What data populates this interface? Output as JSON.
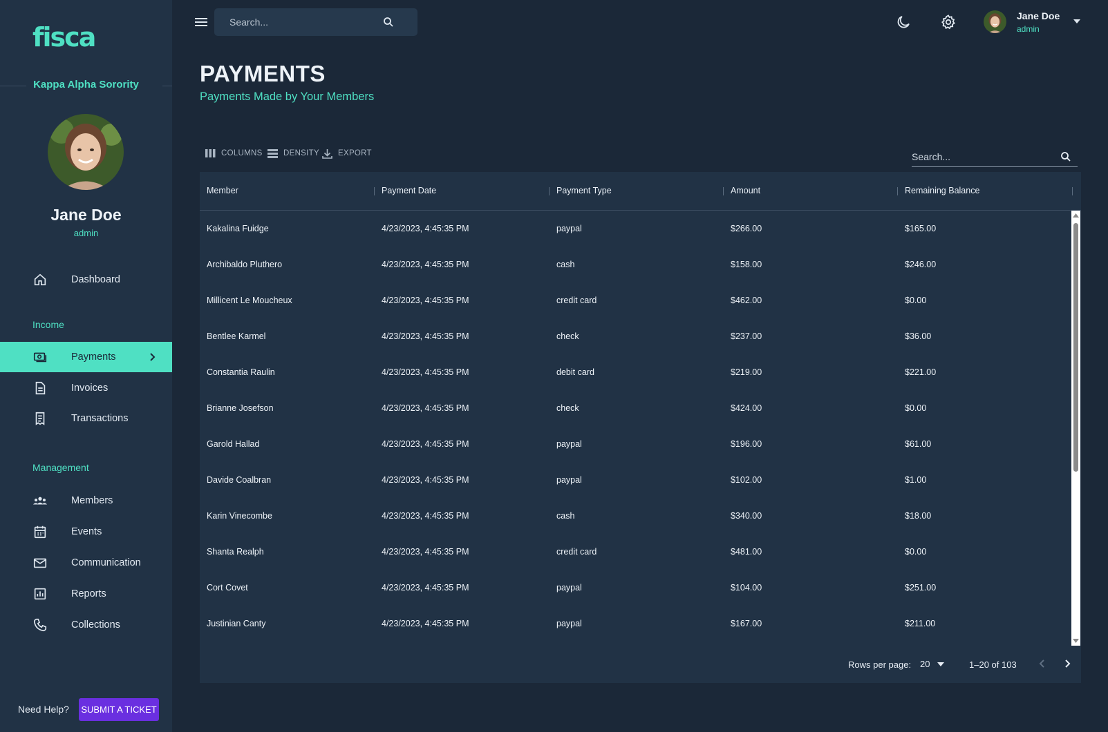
{
  "app": {
    "logo": "fisca",
    "organization": "Kappa Alpha Sorority",
    "accent": "#4fe0c3",
    "background": "#1b2838",
    "sidebar_bg": "#213245",
    "button_color": "#6a2fe0"
  },
  "user": {
    "name": "Jane Doe",
    "role": "admin"
  },
  "sidebar": {
    "items": [
      {
        "label": "Dashboard",
        "icon": "home-icon"
      },
      {
        "label": "Payments",
        "icon": "payments-icon",
        "active": true
      },
      {
        "label": "Invoices",
        "icon": "invoice-icon"
      },
      {
        "label": "Transactions",
        "icon": "receipt-icon"
      },
      {
        "label": "Members",
        "icon": "members-icon"
      },
      {
        "label": "Events",
        "icon": "calendar-icon"
      },
      {
        "label": "Communication",
        "icon": "mail-icon"
      },
      {
        "label": "Reports",
        "icon": "reports-icon"
      },
      {
        "label": "Collections",
        "icon": "phone-icon"
      }
    ],
    "sections": {
      "income": "Income",
      "management": "Management"
    },
    "help_text": "Need Help?",
    "ticket_button": "SUBMIT A TICKET"
  },
  "topbar": {
    "search_placeholder": "Search..."
  },
  "page": {
    "title": "PAYMENTS",
    "subtitle": "Payments Made by Your Members"
  },
  "toolbar": {
    "columns": "COLUMNS",
    "density": "DENSITY",
    "export": "EXPORT",
    "search_placeholder": "Search..."
  },
  "table": {
    "columns": [
      "Member",
      "Payment Date",
      "Payment Type",
      "Amount",
      "Remaining Balance"
    ],
    "rows": [
      [
        "Kakalina Fuidge",
        "4/23/2023, 4:45:35 PM",
        "paypal",
        "$266.00",
        "$165.00"
      ],
      [
        "Archibaldo Pluthero",
        "4/23/2023, 4:45:35 PM",
        "cash",
        "$158.00",
        "$246.00"
      ],
      [
        "Millicent Le Moucheux",
        "4/23/2023, 4:45:35 PM",
        "credit card",
        "$462.00",
        "$0.00"
      ],
      [
        "Bentlee Karmel",
        "4/23/2023, 4:45:35 PM",
        "check",
        "$237.00",
        "$36.00"
      ],
      [
        "Constantia Raulin",
        "4/23/2023, 4:45:35 PM",
        "debit card",
        "$219.00",
        "$221.00"
      ],
      [
        "Brianne Josefson",
        "4/23/2023, 4:45:35 PM",
        "check",
        "$424.00",
        "$0.00"
      ],
      [
        "Garold Hallad",
        "4/23/2023, 4:45:35 PM",
        "paypal",
        "$196.00",
        "$61.00"
      ],
      [
        "Davide Coalbran",
        "4/23/2023, 4:45:35 PM",
        "paypal",
        "$102.00",
        "$1.00"
      ],
      [
        "Karin Vinecombe",
        "4/23/2023, 4:45:35 PM",
        "cash",
        "$340.00",
        "$18.00"
      ],
      [
        "Shanta Realph",
        "4/23/2023, 4:45:35 PM",
        "credit card",
        "$481.00",
        "$0.00"
      ],
      [
        "Cort Covet",
        "4/23/2023, 4:45:35 PM",
        "paypal",
        "$104.00",
        "$251.00"
      ],
      [
        "Justinian Canty",
        "4/23/2023, 4:45:35 PM",
        "paypal",
        "$167.00",
        "$211.00"
      ]
    ]
  },
  "pagination": {
    "rows_per_page_label": "Rows per page:",
    "rows_per_page": "20",
    "range": "1–20 of 103"
  }
}
